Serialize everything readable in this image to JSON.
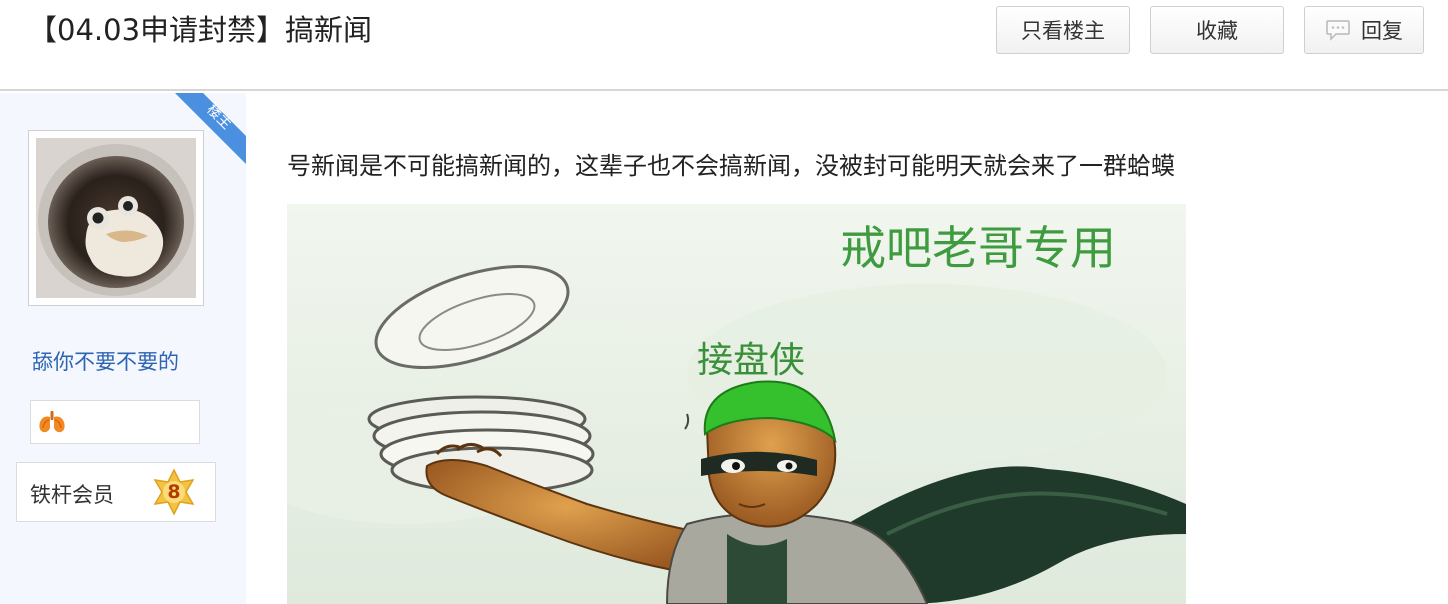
{
  "thread": {
    "title": "【04.03申请封禁】搞新闻"
  },
  "toolbar": {
    "only_owner_label": "只看楼主",
    "favorite_label": "收藏",
    "reply_label": "回复"
  },
  "author": {
    "owner_tag": "楼主",
    "username": "舔你不要不要的",
    "level_title": "铁杆会员",
    "level_number": "8"
  },
  "post": {
    "text": "号新闻是不可能搞新闻的，这辈子也不会搞新闻，没被封可能明天就会来了一群蛤蟆",
    "image_caption_top": "戒吧老哥专用",
    "image_caption_hero": "接盘侠"
  },
  "colors": {
    "link_blue": "#2d64b3",
    "owner_ribbon": "#4a8fe0",
    "sidebar_bg": "#f4f7fd",
    "image_text_green": "#3f9b3f"
  }
}
